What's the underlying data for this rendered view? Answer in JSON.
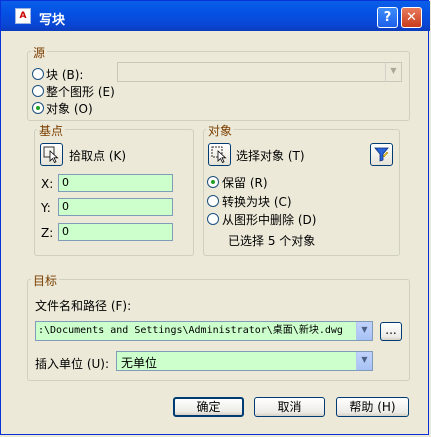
{
  "window": {
    "title": "写块",
    "help_glyph": "?",
    "close_glyph": "✕",
    "app_icon_text": "A"
  },
  "source": {
    "legend": "源",
    "block_label": "块 (B):",
    "block_value": "",
    "entire_drawing_label": "整个图形 (E)",
    "objects_label": "对象 (O)",
    "selected": "objects"
  },
  "base_point": {
    "legend": "基点",
    "pick_label": "拾取点 (K)",
    "x_label": "X:",
    "y_label": "Y:",
    "z_label": "Z:",
    "x_value": "0",
    "y_value": "0",
    "z_value": "0"
  },
  "objects": {
    "legend": "对象",
    "select_label": "选择对象 (T)",
    "retain_label": "保留 (R)",
    "convert_label": "转换为块 (C)",
    "delete_label": "从图形中删除 (D)",
    "selected": "retain",
    "count_text": "已选择 5 个对象"
  },
  "destination": {
    "legend": "目标",
    "path_label": "文件名和路径 (F):",
    "path_value": ":\\Documents and Settings\\Administrator\\桌面\\新块.dwg",
    "browse_label": "...",
    "units_label": "插入单位 (U):",
    "units_value": "无单位"
  },
  "buttons": {
    "ok": "确定",
    "cancel": "取消",
    "help": "帮助 (H)"
  },
  "colors": {
    "titlebar": "#0451e3",
    "field_bg": "#ccffcc",
    "legend_text": "#7a3e00"
  },
  "icons": {
    "pick_point": "pick-point-icon",
    "select_objects": "select-objects-icon",
    "quick_select": "quick-select-filter-icon"
  }
}
